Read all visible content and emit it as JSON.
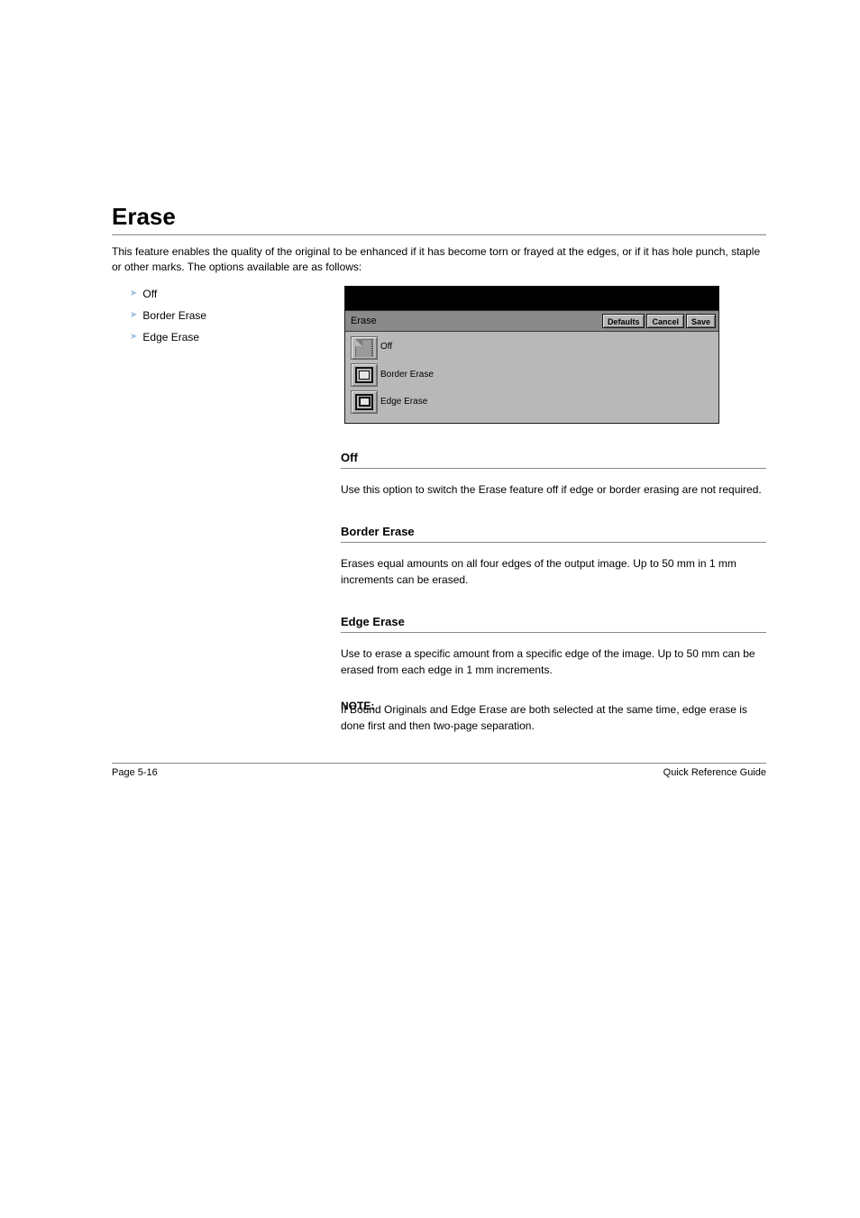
{
  "section": {
    "heading": "Erase",
    "intro": "This feature enables the quality of the original to be enhanced if it has become torn or frayed at the edges, or if it has hole punch, staple or other marks. The options available are as follows:"
  },
  "bullets": {
    "off": "Off",
    "border": "Border Erase",
    "edge": "Edge Erase"
  },
  "panel": {
    "title": "Erase",
    "buttons": {
      "defaults": "Defaults",
      "cancel": "Cancel",
      "save": "Save"
    },
    "options": {
      "off": "Off",
      "border": "Border Erase",
      "edge": "Edge Erase"
    }
  },
  "off": {
    "title": "Off",
    "desc": "Use this option to switch the Erase feature off if edge or border erasing are not required."
  },
  "border": {
    "title": "Border Erase",
    "desc": "Erases equal amounts on all four edges of the output image. Up to 50 mm in 1 mm increments can be erased."
  },
  "edge": {
    "title": "Edge Erase",
    "desc": "Use to erase a specific amount from a specific edge of the image. Up to 50 mm can be erased from each edge in 1 mm increments."
  },
  "note": {
    "label": "NOTE:",
    "desc": "If Bound Originals and Edge Erase are both selected at the same time, edge erase is done first and then two-page separation."
  },
  "footer": {
    "left": "Page 5-16",
    "right": "Quick Reference Guide"
  }
}
